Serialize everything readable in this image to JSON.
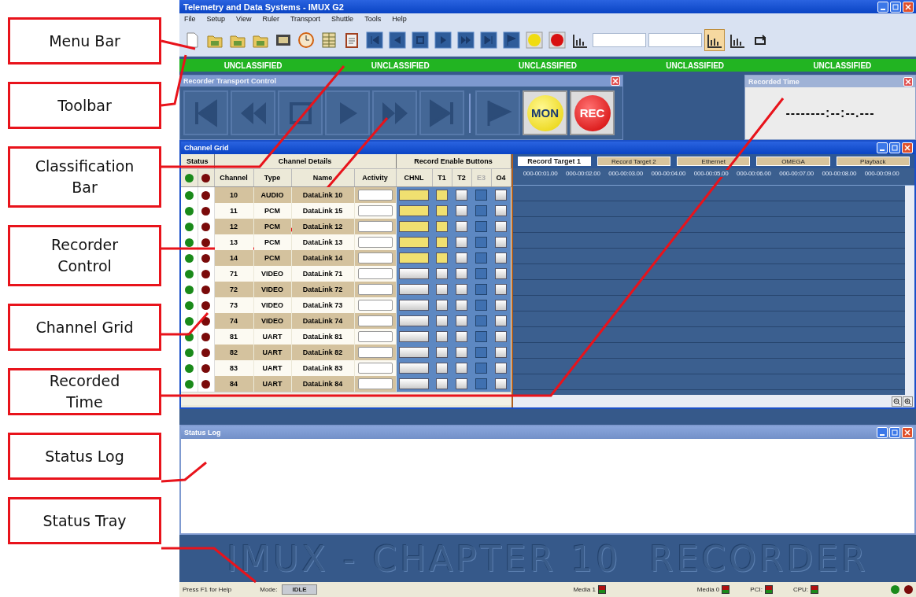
{
  "callouts": [
    {
      "label": "Menu Bar"
    },
    {
      "label": "Toolbar"
    },
    {
      "label": "Classification Bar"
    },
    {
      "label": "Recorder Control"
    },
    {
      "label": "Channel Grid"
    },
    {
      "label": "Recorded Time"
    },
    {
      "label": "Status Log"
    },
    {
      "label": "Status Tray"
    }
  ],
  "window": {
    "title": "Telemetry and Data Systems - IMUX G2"
  },
  "menu": [
    "File",
    "Setup",
    "View",
    "Ruler",
    "Transport",
    "Shuttle",
    "Tools",
    "Help"
  ],
  "toolbar": [
    {
      "kind": "page",
      "selected": false
    },
    {
      "kind": "folder",
      "selected": false
    },
    {
      "kind": "folder",
      "selected": false
    },
    {
      "kind": "folder",
      "selected": false
    },
    {
      "kind": "film",
      "selected": false
    },
    {
      "kind": "clock",
      "selected": false
    },
    {
      "kind": "grid",
      "selected": false
    },
    {
      "kind": "clipboard",
      "selected": false
    },
    {
      "kind": "first",
      "selected": false
    },
    {
      "kind": "prev",
      "selected": false
    },
    {
      "kind": "stop",
      "selected": false
    },
    {
      "kind": "play",
      "selected": false
    },
    {
      "kind": "next",
      "selected": false
    },
    {
      "kind": "last",
      "selected": false
    },
    {
      "kind": "flag",
      "selected": false
    },
    {
      "kind": "mon",
      "selected": false
    },
    {
      "kind": "rec",
      "selected": false
    },
    {
      "kind": "bars",
      "selected": false
    },
    {
      "kind": "field"
    },
    {
      "kind": "field"
    },
    {
      "kind": "bars",
      "selected": true
    },
    {
      "kind": "bars",
      "selected": false
    },
    {
      "kind": "loop",
      "selected": false
    }
  ],
  "classification": [
    "UNCLASSIFIED",
    "UNCLASSIFIED",
    "UNCLASSIFIED",
    "UNCLASSIFIED",
    "UNCLASSIFIED"
  ],
  "transport": {
    "title": "Recorder Transport Control",
    "buttons": [
      {
        "kind": "first",
        "disabled": true
      },
      {
        "kind": "rewind",
        "disabled": true
      },
      {
        "kind": "stop",
        "disabled": true
      },
      {
        "kind": "play",
        "disabled": true
      },
      {
        "kind": "forward",
        "disabled": true
      },
      {
        "kind": "last",
        "disabled": true
      },
      {
        "kind": "flag",
        "disabled": true
      },
      {
        "kind": "mon",
        "label": "MON",
        "disabled": false
      },
      {
        "kind": "rec",
        "label": "REC",
        "disabled": false
      }
    ]
  },
  "recorded_time": {
    "title": "Recorded Time",
    "value": "--------:--:--.---"
  },
  "channel_grid": {
    "title": "Channel Grid",
    "groups": [
      "Status",
      "Channel Details",
      "Record Enable Buttons"
    ],
    "columns": [
      "Channel",
      "Type",
      "Name",
      "Activity"
    ],
    "enable_columns": [
      {
        "label": "CHNL",
        "disabled": false
      },
      {
        "label": "T1",
        "disabled": false
      },
      {
        "label": "T2",
        "disabled": false
      },
      {
        "label": "E3",
        "disabled": true
      },
      {
        "label": "O4",
        "disabled": false
      }
    ],
    "rows": [
      {
        "channel": "10",
        "type": "AUDIO",
        "name": "DataLink 10",
        "enable": [
          true,
          true,
          false,
          false
        ]
      },
      {
        "channel": "11",
        "type": "PCM",
        "name": "DataLink 15",
        "enable": [
          true,
          true,
          false,
          false
        ]
      },
      {
        "channel": "12",
        "type": "PCM",
        "name": "DataLink 12",
        "enable": [
          true,
          true,
          false,
          false
        ]
      },
      {
        "channel": "13",
        "type": "PCM",
        "name": "DataLink 13",
        "enable": [
          true,
          true,
          false,
          false
        ]
      },
      {
        "channel": "14",
        "type": "PCM",
        "name": "DataLink 14",
        "enable": [
          true,
          true,
          false,
          false
        ]
      },
      {
        "channel": "71",
        "type": "VIDEO",
        "name": "DataLink 71",
        "enable": [
          false,
          false,
          false,
          false
        ]
      },
      {
        "channel": "72",
        "type": "VIDEO",
        "name": "DataLink 72",
        "enable": [
          false,
          false,
          false,
          false
        ]
      },
      {
        "channel": "73",
        "type": "VIDEO",
        "name": "DataLink 73",
        "enable": [
          false,
          false,
          false,
          false
        ]
      },
      {
        "channel": "74",
        "type": "VIDEO",
        "name": "DataLink 74",
        "enable": [
          false,
          false,
          false,
          false
        ]
      },
      {
        "channel": "81",
        "type": "UART",
        "name": "DataLink 81",
        "enable": [
          false,
          false,
          false,
          false
        ]
      },
      {
        "channel": "82",
        "type": "UART",
        "name": "DataLink 82",
        "enable": [
          false,
          false,
          false,
          false
        ]
      },
      {
        "channel": "83",
        "type": "UART",
        "name": "DataLink 83",
        "enable": [
          false,
          false,
          false,
          false
        ]
      },
      {
        "channel": "84",
        "type": "UART",
        "name": "DataLink 84",
        "enable": [
          false,
          false,
          false,
          false
        ]
      }
    ],
    "targets": [
      {
        "label": "Record Target 1",
        "selected": true
      },
      {
        "label": "Record Target 2",
        "selected": false
      },
      {
        "label": "Ethernet",
        "selected": false
      },
      {
        "label": "OMEGA",
        "selected": false
      },
      {
        "label": "Playback",
        "selected": false
      }
    ],
    "ticks": [
      "000-00:01.00",
      "000-00:02.00",
      "000-00:03.00",
      "000-00:04.00",
      "000-00:05.00",
      "000-00:06.00",
      "000-00:07.00",
      "000-00:08.00",
      "000-00:09.00"
    ]
  },
  "status_log": {
    "title": "Status Log"
  },
  "banner": "IMUX - CHAPTER 10  RECORDER",
  "status_bar": {
    "help": "Press F1 for Help",
    "mode_label": "Mode:",
    "mode": "IDLE",
    "indicators": [
      {
        "label": "Media 1"
      },
      {
        "label": "Media 0"
      },
      {
        "label": "PCI:"
      },
      {
        "label": "CPU:"
      }
    ]
  }
}
